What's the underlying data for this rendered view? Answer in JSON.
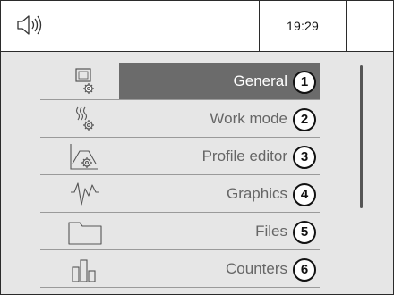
{
  "status_bar": {
    "sound_icon": "speaker-icon",
    "time": "19:29"
  },
  "menu": {
    "selected_index": 0,
    "items": [
      {
        "label": "General",
        "number": "1",
        "icon": "settings-monitor-icon"
      },
      {
        "label": "Work mode",
        "number": "2",
        "icon": "heat-gear-icon"
      },
      {
        "label": "Profile editor",
        "number": "3",
        "icon": "profile-gear-icon"
      },
      {
        "label": "Graphics",
        "number": "4",
        "icon": "graph-icon"
      },
      {
        "label": "Files",
        "number": "5",
        "icon": "folder-icon"
      },
      {
        "label": "Counters",
        "number": "6",
        "icon": "counters-icon"
      }
    ]
  },
  "colors": {
    "selected_bg": "#6b6b6b",
    "screen_bg": "#e6e6e6",
    "text": "#666666"
  }
}
